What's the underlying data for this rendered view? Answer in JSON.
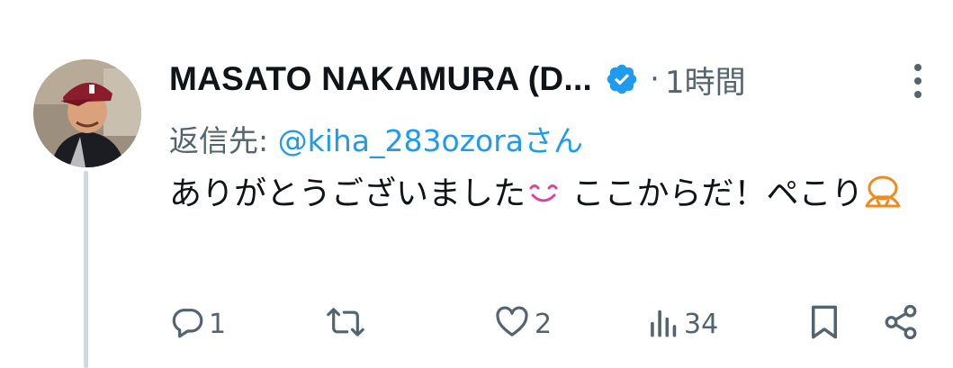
{
  "tweet": {
    "display_name": "MASATO NAKAMURA (D...",
    "verified_icon": "verified-badge-icon",
    "separator": "·",
    "time": "1時間",
    "reply_label": "返信先: ",
    "reply_handle": "@kiha_283ozora",
    "reply_suffix": "さん",
    "text_part1": "ありがとうございました",
    "text_part2": " ここからだ！ペこり",
    "emoji_1": "smiling-face-icon",
    "emoji_2": "bowing-person-icon"
  },
  "actions": {
    "reply_count": "1",
    "retweet_count": "",
    "like_count": "2",
    "views_count": "34"
  },
  "colors": {
    "accent": "#1d9bf0",
    "secondary_text": "#536471",
    "thread_line": "#cfd9de",
    "verified": "#1d9bf0"
  }
}
